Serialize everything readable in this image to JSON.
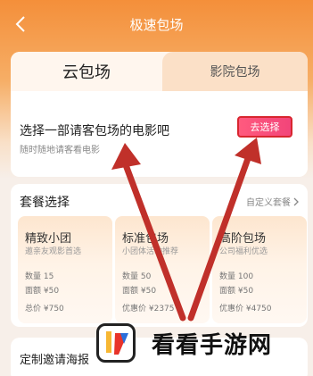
{
  "header": {
    "title": "极速包场",
    "back_icon": "chevron-left-icon"
  },
  "tabs": [
    {
      "label": "云包场",
      "active": true
    },
    {
      "label": "影院包场",
      "active": false
    }
  ],
  "select": {
    "title": "选择一部请客包场的电影吧",
    "subtitle": "随时随地请客看电影",
    "button_label": "去选择"
  },
  "packages": {
    "title": "套餐选择",
    "custom_label": "自定义套餐",
    "items": [
      {
        "name": "精致小团",
        "desc": "邀亲友观影首选",
        "count": "数量 15",
        "face": "面额 ¥50",
        "total": "总价 ¥750"
      },
      {
        "name": "标准包场",
        "desc": "小团体活动推荐",
        "count": "数量 50",
        "face": "面额 ¥50",
        "total": "优惠价 ¥2375"
      },
      {
        "name": "高阶包场",
        "desc": "公司福利优选",
        "count": "数量 100",
        "face": "面额 ¥50",
        "total": "优惠价 ¥4750"
      }
    ]
  },
  "invite": {
    "title": "定制邀请海报"
  },
  "watermark": {
    "text": "看看手游网"
  },
  "colors": {
    "accent": "#f48f3a",
    "button": "#f2457a",
    "annotation": "#c0302a"
  }
}
